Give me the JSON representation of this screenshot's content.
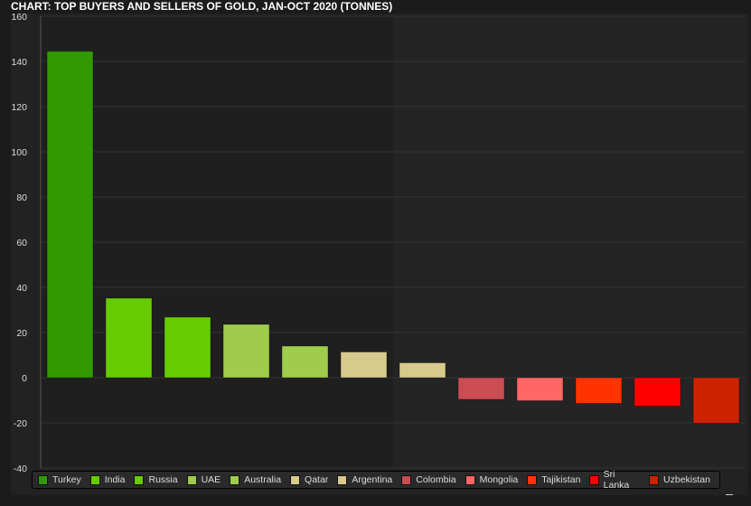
{
  "chart_data": {
    "type": "bar",
    "title": "CHART: TOP BUYERS AND SELLERS OF GOLD, JAN-OCT 2020 (TONNES)",
    "categories": [
      "Turkey",
      "India",
      "Russia",
      "UAE",
      "Australia",
      "Qatar",
      "Argentina",
      "Colombia",
      "Mongolia",
      "Tajikistan",
      "Sri Lanka",
      "Uzbekistan"
    ],
    "values": [
      144.5,
      35.2,
      26.8,
      23.6,
      14.0,
      11.4,
      6.6,
      -9.6,
      -10.2,
      -11.4,
      -12.6,
      -20.2
    ],
    "colors": [
      "#339900",
      "#66cc00",
      "#66cc00",
      "#a0cc4c",
      "#a0cc4c",
      "#d8c98c",
      "#d8c98c",
      "#cc4c53",
      "#ff6666",
      "#ff3300",
      "#ff0000",
      "#cc2200"
    ],
    "ylim": [
      -40,
      160
    ],
    "yticks": [
      -40,
      -20,
      0,
      20,
      40,
      60,
      80,
      100,
      120,
      140,
      160
    ],
    "grid": true,
    "legend": "bottom",
    "xlabel": "",
    "ylabel": ""
  }
}
